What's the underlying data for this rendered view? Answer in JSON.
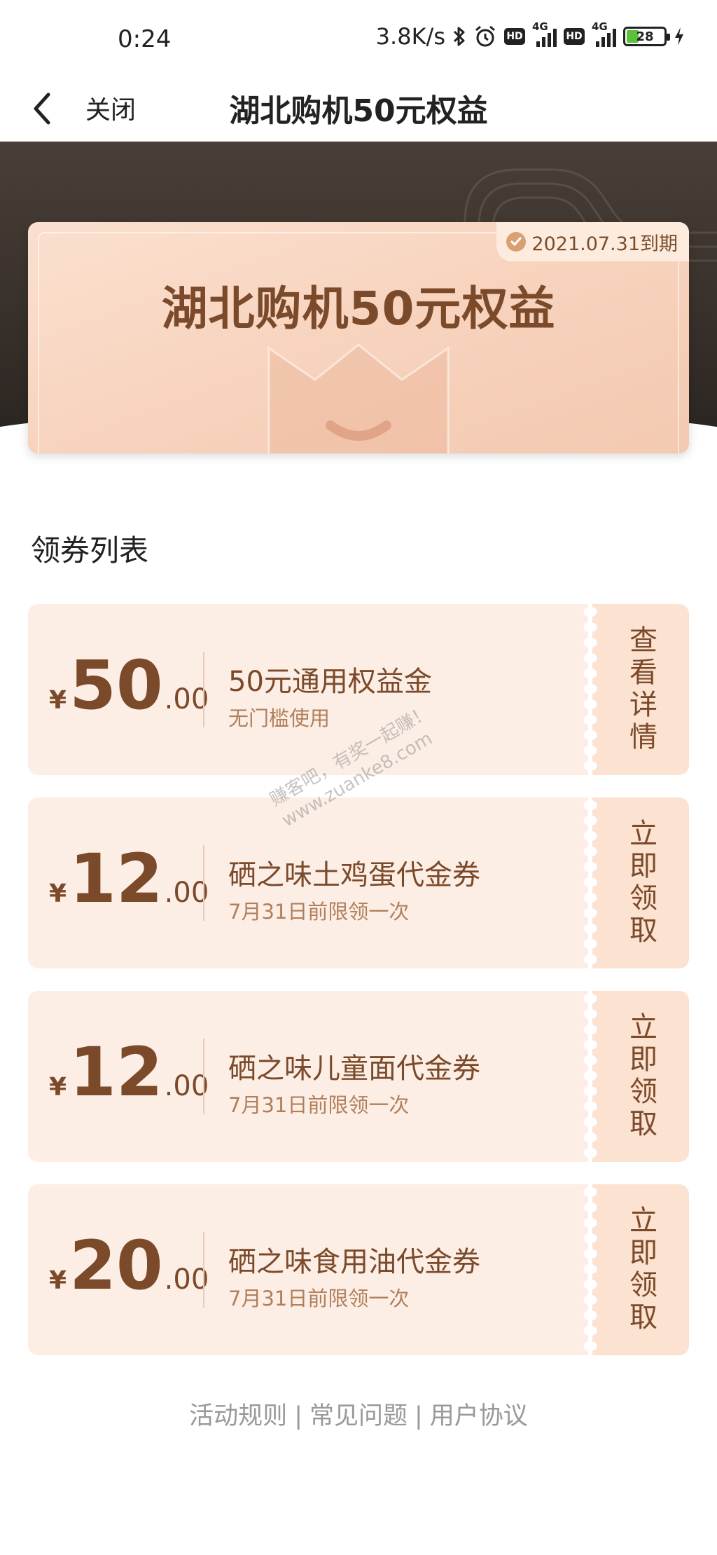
{
  "status_bar": {
    "time": "0:24",
    "net_speed": "3.8K/s",
    "network_type_1": "4G",
    "network_type_2": "4G",
    "hd_label": "HD",
    "battery": "28"
  },
  "nav": {
    "close_label": "关闭",
    "title": "湖北购机50元权益"
  },
  "hero": {
    "title": "湖北购机50元权益",
    "expiry": "2021.07.31到期"
  },
  "section_title": "领券列表",
  "coupons": [
    {
      "currency": "¥",
      "amount_int": "50",
      "amount_dec": ".00",
      "name": "50元通用权益金",
      "desc": "无门槛使用",
      "action": "查看详情"
    },
    {
      "currency": "¥",
      "amount_int": "12",
      "amount_dec": ".00",
      "name": "硒之味土鸡蛋代金券",
      "desc": "7月31日前限领一次",
      "action": "立即领取"
    },
    {
      "currency": "¥",
      "amount_int": "12",
      "amount_dec": ".00",
      "name": "硒之味儿童面代金券",
      "desc": "7月31日前限领一次",
      "action": "立即领取"
    },
    {
      "currency": "¥",
      "amount_int": "20",
      "amount_dec": ".00",
      "name": "硒之味食用油代金券",
      "desc": "7月31日前限领一次",
      "action": "立即领取"
    }
  ],
  "footer": {
    "links": [
      "活动规则",
      "常见问题",
      "用户协议"
    ],
    "separator": "|"
  },
  "watermark": {
    "line1": "赚客吧，有奖一起赚！",
    "line2": "www.zuanke8.com"
  },
  "colors": {
    "accent_brown": "#7b4a2a",
    "coupon_bg": "#fdeee5",
    "coupon_side_bg": "#fce2d0",
    "hero_dark": "#3a322c"
  }
}
